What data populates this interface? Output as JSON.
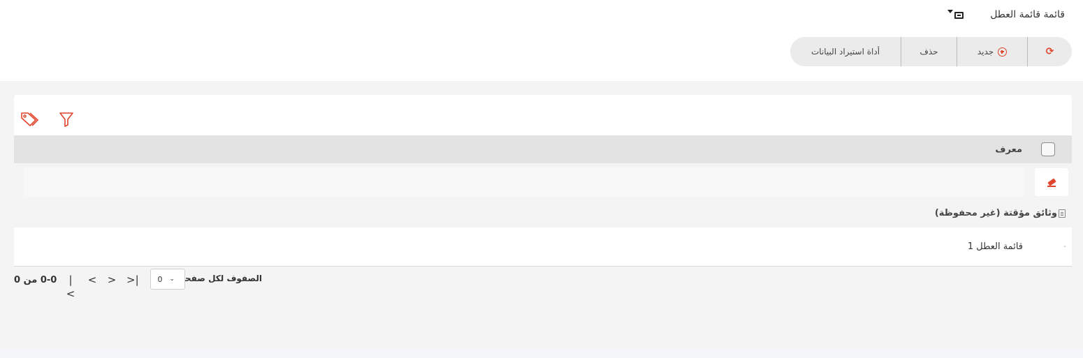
{
  "header": {
    "title": "قائمة قائمة العطل",
    "view_switch_icon": "monitor-dropdown-icon"
  },
  "toolbar": {
    "refresh_icon": "refresh-icon",
    "new_label": "جديد",
    "new_icon": "plus-circle-icon",
    "delete_label": "حذف",
    "import_label": "أداة استيراد البيانات"
  },
  "grid": {
    "tools": [
      "tag-icon",
      "filter-icon"
    ],
    "column_header": "معرف",
    "filter_clear_icon": "eraser-icon",
    "temp_docs_label": "وثائق مؤقتة (غير محفوظة)",
    "rows": [
      {
        "dash": "-",
        "name": "قائمة العطل 1"
      }
    ]
  },
  "pagination": {
    "rows_per_page_label": "الصفوف لكل صفحة",
    "rows_per_page_value": "0",
    "range_text": "0-0 من 0"
  },
  "colors": {
    "accent": "#e0452d",
    "toolbar_bg": "#ebebeb",
    "content_bg": "#f4f4f4",
    "header_row_bg": "#e3e3e3"
  }
}
